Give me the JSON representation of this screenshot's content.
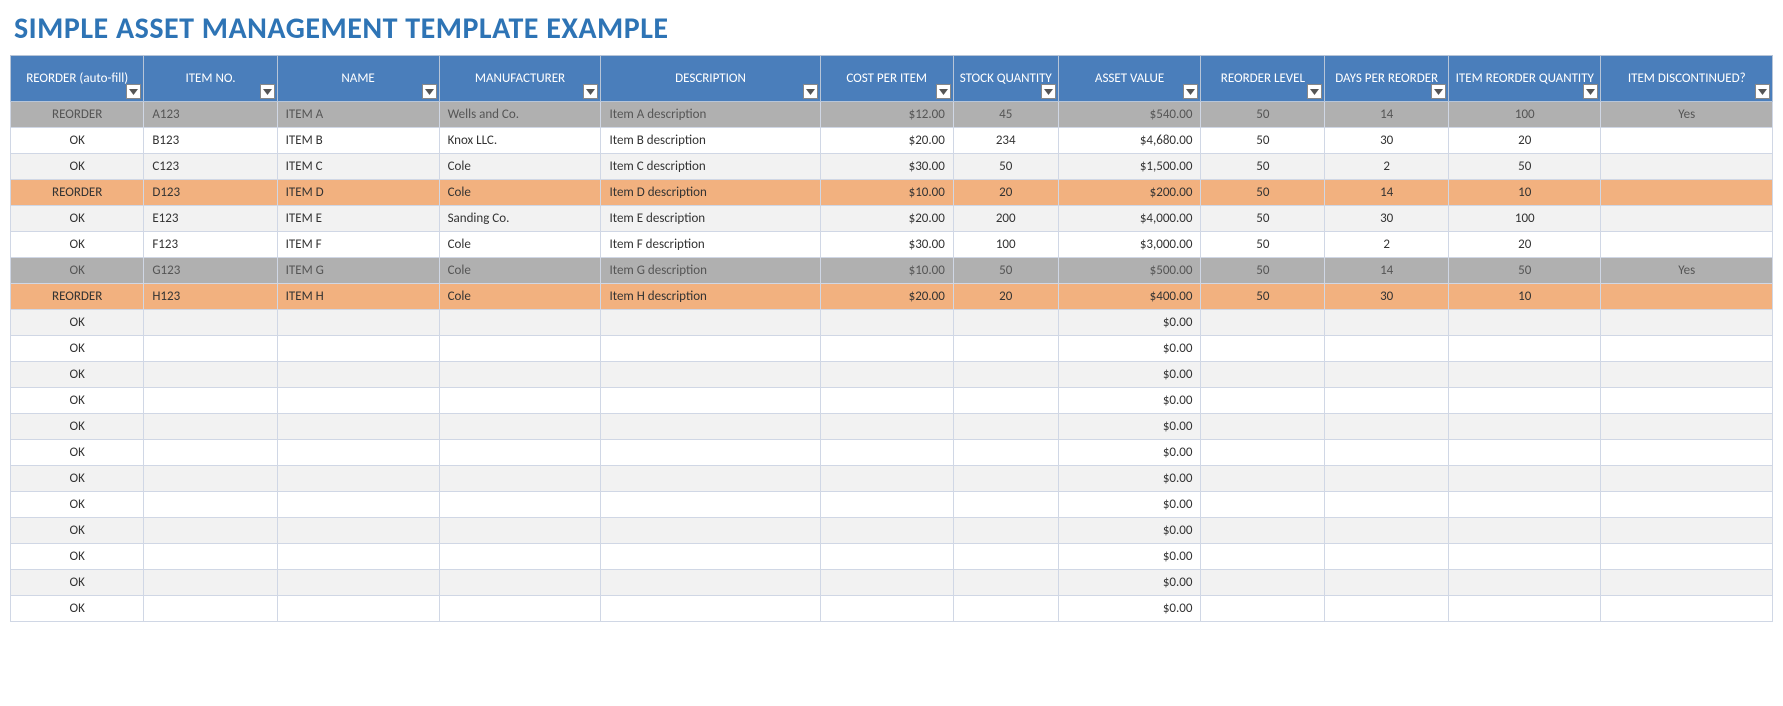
{
  "title": "SIMPLE ASSET MANAGEMENT TEMPLATE EXAMPLE",
  "headers": {
    "status": "REORDER (auto-fill)",
    "itemno": "ITEM NO.",
    "name": "NAME",
    "manufacturer": "MANUFACTURER",
    "description": "DESCRIPTION",
    "cost": "COST PER ITEM",
    "stock": "STOCK QUANTITY",
    "asset": "ASSET VALUE",
    "level": "REORDER LEVEL",
    "days": "DAYS PER REORDER",
    "qty": "ITEM REORDER QUANTITY",
    "disc": "ITEM DISCONTINUED?"
  },
  "rows": [
    {
      "style": "discontinued",
      "status": "REORDER",
      "itemno": "A123",
      "name": "ITEM A",
      "manufacturer": "Wells and Co.",
      "description": "Item A description",
      "cost": "$12.00",
      "stock": "45",
      "asset": "$540.00",
      "level": "50",
      "days": "14",
      "qty": "100",
      "disc": "Yes"
    },
    {
      "style": "",
      "status": "OK",
      "itemno": "B123",
      "name": "ITEM B",
      "manufacturer": "Knox LLC.",
      "description": "Item B description",
      "cost": "$20.00",
      "stock": "234",
      "asset": "$4,680.00",
      "level": "50",
      "days": "30",
      "qty": "20",
      "disc": ""
    },
    {
      "style": "alt",
      "status": "OK",
      "itemno": "C123",
      "name": "ITEM C",
      "manufacturer": "Cole",
      "description": "Item C description",
      "cost": "$30.00",
      "stock": "50",
      "asset": "$1,500.00",
      "level": "50",
      "days": "2",
      "qty": "50",
      "disc": ""
    },
    {
      "style": "reorder",
      "status": "REORDER",
      "itemno": "D123",
      "name": "ITEM D",
      "manufacturer": "Cole",
      "description": "Item D description",
      "cost": "$10.00",
      "stock": "20",
      "asset": "$200.00",
      "level": "50",
      "days": "14",
      "qty": "10",
      "disc": ""
    },
    {
      "style": "alt",
      "status": "OK",
      "itemno": "E123",
      "name": "ITEM E",
      "manufacturer": "Sanding Co.",
      "description": "Item E description",
      "cost": "$20.00",
      "stock": "200",
      "asset": "$4,000.00",
      "level": "50",
      "days": "30",
      "qty": "100",
      "disc": ""
    },
    {
      "style": "",
      "status": "OK",
      "itemno": "F123",
      "name": "ITEM F",
      "manufacturer": "Cole",
      "description": "Item F description",
      "cost": "$30.00",
      "stock": "100",
      "asset": "$3,000.00",
      "level": "50",
      "days": "2",
      "qty": "20",
      "disc": ""
    },
    {
      "style": "discontinued",
      "status": "OK",
      "itemno": "G123",
      "name": "ITEM G",
      "manufacturer": "Cole",
      "description": "Item G description",
      "cost": "$10.00",
      "stock": "50",
      "asset": "$500.00",
      "level": "50",
      "days": "14",
      "qty": "50",
      "disc": "Yes"
    },
    {
      "style": "reorder",
      "status": "REORDER",
      "itemno": "H123",
      "name": "ITEM H",
      "manufacturer": "Cole",
      "description": "Item H description",
      "cost": "$20.00",
      "stock": "20",
      "asset": "$400.00",
      "level": "50",
      "days": "30",
      "qty": "10",
      "disc": ""
    },
    {
      "style": "alt",
      "status": "OK",
      "itemno": "",
      "name": "",
      "manufacturer": "",
      "description": "",
      "cost": "",
      "stock": "",
      "asset": "$0.00",
      "level": "",
      "days": "",
      "qty": "",
      "disc": ""
    },
    {
      "style": "",
      "status": "OK",
      "itemno": "",
      "name": "",
      "manufacturer": "",
      "description": "",
      "cost": "",
      "stock": "",
      "asset": "$0.00",
      "level": "",
      "days": "",
      "qty": "",
      "disc": ""
    },
    {
      "style": "alt",
      "status": "OK",
      "itemno": "",
      "name": "",
      "manufacturer": "",
      "description": "",
      "cost": "",
      "stock": "",
      "asset": "$0.00",
      "level": "",
      "days": "",
      "qty": "",
      "disc": ""
    },
    {
      "style": "",
      "status": "OK",
      "itemno": "",
      "name": "",
      "manufacturer": "",
      "description": "",
      "cost": "",
      "stock": "",
      "asset": "$0.00",
      "level": "",
      "days": "",
      "qty": "",
      "disc": ""
    },
    {
      "style": "alt",
      "status": "OK",
      "itemno": "",
      "name": "",
      "manufacturer": "",
      "description": "",
      "cost": "",
      "stock": "",
      "asset": "$0.00",
      "level": "",
      "days": "",
      "qty": "",
      "disc": ""
    },
    {
      "style": "",
      "status": "OK",
      "itemno": "",
      "name": "",
      "manufacturer": "",
      "description": "",
      "cost": "",
      "stock": "",
      "asset": "$0.00",
      "level": "",
      "days": "",
      "qty": "",
      "disc": ""
    },
    {
      "style": "alt",
      "status": "OK",
      "itemno": "",
      "name": "",
      "manufacturer": "",
      "description": "",
      "cost": "",
      "stock": "",
      "asset": "$0.00",
      "level": "",
      "days": "",
      "qty": "",
      "disc": ""
    },
    {
      "style": "",
      "status": "OK",
      "itemno": "",
      "name": "",
      "manufacturer": "",
      "description": "",
      "cost": "",
      "stock": "",
      "asset": "$0.00",
      "level": "",
      "days": "",
      "qty": "",
      "disc": ""
    },
    {
      "style": "alt",
      "status": "OK",
      "itemno": "",
      "name": "",
      "manufacturer": "",
      "description": "",
      "cost": "",
      "stock": "",
      "asset": "$0.00",
      "level": "",
      "days": "",
      "qty": "",
      "disc": ""
    },
    {
      "style": "",
      "status": "OK",
      "itemno": "",
      "name": "",
      "manufacturer": "",
      "description": "",
      "cost": "",
      "stock": "",
      "asset": "$0.00",
      "level": "",
      "days": "",
      "qty": "",
      "disc": ""
    },
    {
      "style": "alt",
      "status": "OK",
      "itemno": "",
      "name": "",
      "manufacturer": "",
      "description": "",
      "cost": "",
      "stock": "",
      "asset": "$0.00",
      "level": "",
      "days": "",
      "qty": "",
      "disc": ""
    },
    {
      "style": "",
      "status": "OK",
      "itemno": "",
      "name": "",
      "manufacturer": "",
      "description": "",
      "cost": "",
      "stock": "",
      "asset": "$0.00",
      "level": "",
      "days": "",
      "qty": "",
      "disc": ""
    }
  ]
}
